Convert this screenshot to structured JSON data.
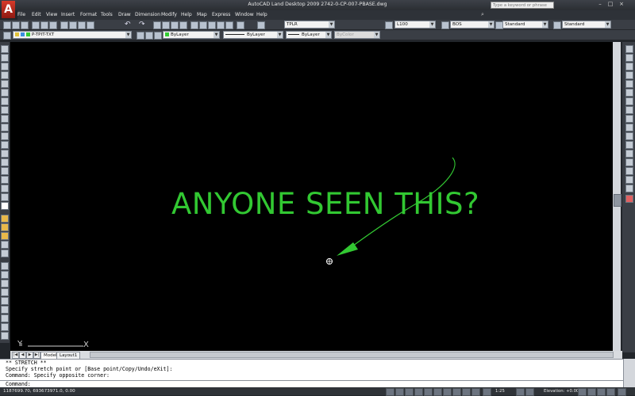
{
  "window": {
    "title": "AutoCAD Land Desktop 2009 2742-0-CP-007-PBASE.dwg",
    "app_logo": "A",
    "controls": [
      "–",
      "□",
      "×"
    ]
  },
  "search": {
    "placeholder": "Type a keyword or phrase"
  },
  "menu": {
    "items": [
      "File",
      "Edit",
      "View",
      "Insert",
      "Format",
      "Tools",
      "Draw",
      "Dimension",
      "Modify",
      "Help",
      "Map",
      "Express",
      "Window",
      "Help"
    ]
  },
  "toolbar": {
    "text_style": "TPLR",
    "dim_style": "L100",
    "table_style": "BOS",
    "plot_style": "Standard",
    "multileader_style": "Standard"
  },
  "properties": {
    "layer_name": "P-TPIT-TXT",
    "color": "ByLayer",
    "linetype": "ByLayer",
    "lineweight": "ByLayer",
    "plot_style": "ByColor",
    "layer_color_hex": "#33cc33"
  },
  "canvas": {
    "annotation_text": "ANYONE SEEN THIS?",
    "annotation_color": "#32c832",
    "background": "#000000",
    "ucs_x": "X",
    "ucs_y": "Y"
  },
  "tabs": [
    "Model",
    "Layout1"
  ],
  "command": {
    "history": [
      "** STRETCH **",
      "Specify stretch point or [Base point/Copy/Undo/eXit]:",
      "Command: Specify opposite corner:"
    ],
    "prompt": "Command:"
  },
  "status": {
    "coordinates": "1187699.70, 693673971.0, 0.00",
    "zoom": "1:25",
    "elevation": "Elevation: +0.00"
  },
  "icons": {
    "top_toolbar": [
      "new-icon",
      "open-icon",
      "save-icon",
      "plot-icon",
      "preview-icon",
      "publish-icon",
      "cut-icon",
      "copy-icon",
      "paste-icon",
      "matchprop-icon",
      "undo-icon",
      "redo-icon",
      "pan-icon",
      "zoom-realtime-icon",
      "zoom-window-icon",
      "zoom-previous-icon",
      "properties-icon",
      "designcenter-icon",
      "tool-palettes-icon",
      "help-icon"
    ],
    "left_draw": [
      "line-icon",
      "construction-line-icon",
      "polyline-icon",
      "polygon-icon",
      "rectangle-icon",
      "arc-icon",
      "circle-icon",
      "revcloud-icon",
      "spline-icon",
      "ellipse-icon",
      "ellipse-arc-icon",
      "insert-block-icon",
      "make-block-icon",
      "point-icon",
      "hatch-icon",
      "gradient-icon",
      "region-icon",
      "table-icon",
      "mtext-icon"
    ],
    "right_modify": [
      "erase-icon",
      "copy-object-icon",
      "mirror-icon",
      "offset-icon",
      "array-icon",
      "move-icon",
      "rotate-icon",
      "scale-icon",
      "stretch-icon",
      "trim-icon",
      "extend-icon",
      "break-at-point-icon",
      "break-icon",
      "join-icon",
      "chamfer-icon",
      "fillet-icon",
      "explode-icon"
    ]
  }
}
